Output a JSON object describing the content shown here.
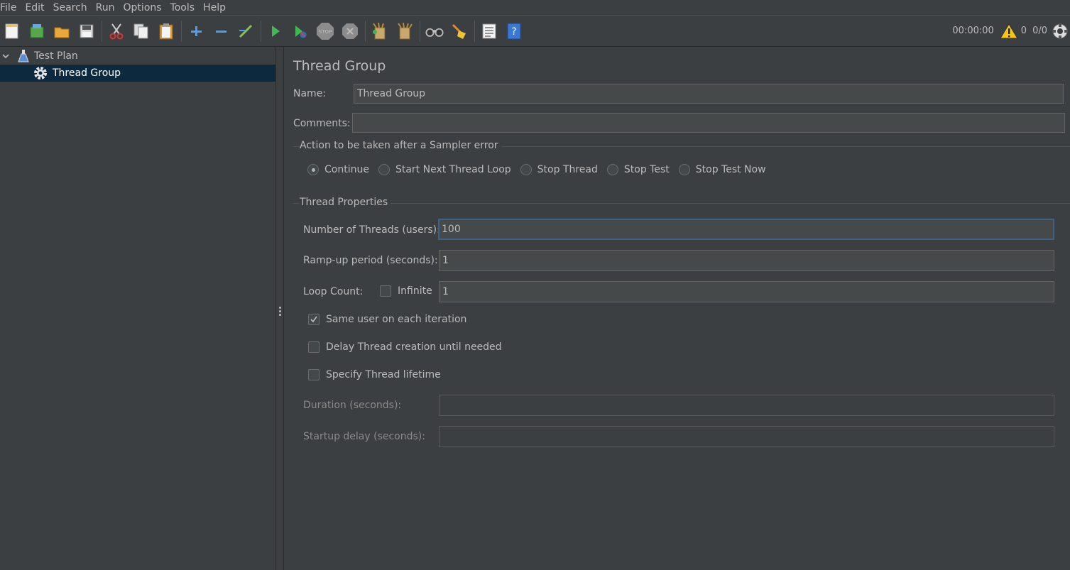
{
  "menu": {
    "items": [
      {
        "label": "File"
      },
      {
        "label": "Edit"
      },
      {
        "label": "Search"
      },
      {
        "label": "Run"
      },
      {
        "label": "Options"
      },
      {
        "label": "Tools"
      },
      {
        "label": "Help"
      }
    ]
  },
  "toolbar": {
    "timer": "00:00:00",
    "warning_count": "0",
    "threads_ratio": "0/0",
    "icons": [
      "new-icon",
      "templates-icon",
      "open-icon",
      "save-icon",
      "cut-icon",
      "copy-icon",
      "paste-icon",
      "expand-icon",
      "collapse-icon",
      "toggle-icon",
      "start-icon",
      "start-no-timers-icon",
      "stop-icon",
      "shutdown-icon",
      "clear-icon",
      "clear-all-icon",
      "search-icon",
      "reset-search-icon",
      "function-helper-icon",
      "help-icon",
      "warning-icon",
      "remote-icon"
    ]
  },
  "tree": {
    "root": {
      "label": "Test Plan"
    },
    "child": {
      "label": "Thread Group"
    }
  },
  "panel": {
    "title": "Thread Group",
    "name_label": "Name:",
    "name_value": "Thread Group",
    "comments_label": "Comments:",
    "comments_value": "",
    "sampler_error": {
      "title": "Action to be taken after a Sampler error",
      "options": [
        "Continue",
        "Start Next Thread Loop",
        "Stop Thread",
        "Stop Test",
        "Stop Test Now"
      ],
      "selected": "Continue"
    },
    "thread_props": {
      "title": "Thread Properties",
      "threads_label": "Number of Threads (users):",
      "threads_value": "100",
      "rampup_label": "Ramp-up period (seconds):",
      "rampup_value": "1",
      "loop_label": "Loop Count:",
      "infinite_label": "Infinite",
      "infinite_checked": false,
      "loop_value": "1",
      "same_user_label": "Same user on each iteration",
      "same_user_checked": true,
      "delay_label": "Delay Thread creation until needed",
      "delay_checked": false,
      "lifetime_label": "Specify Thread lifetime",
      "lifetime_checked": false,
      "duration_label": "Duration (seconds):",
      "duration_value": "",
      "startup_label": "Startup delay (seconds):",
      "startup_value": ""
    }
  }
}
